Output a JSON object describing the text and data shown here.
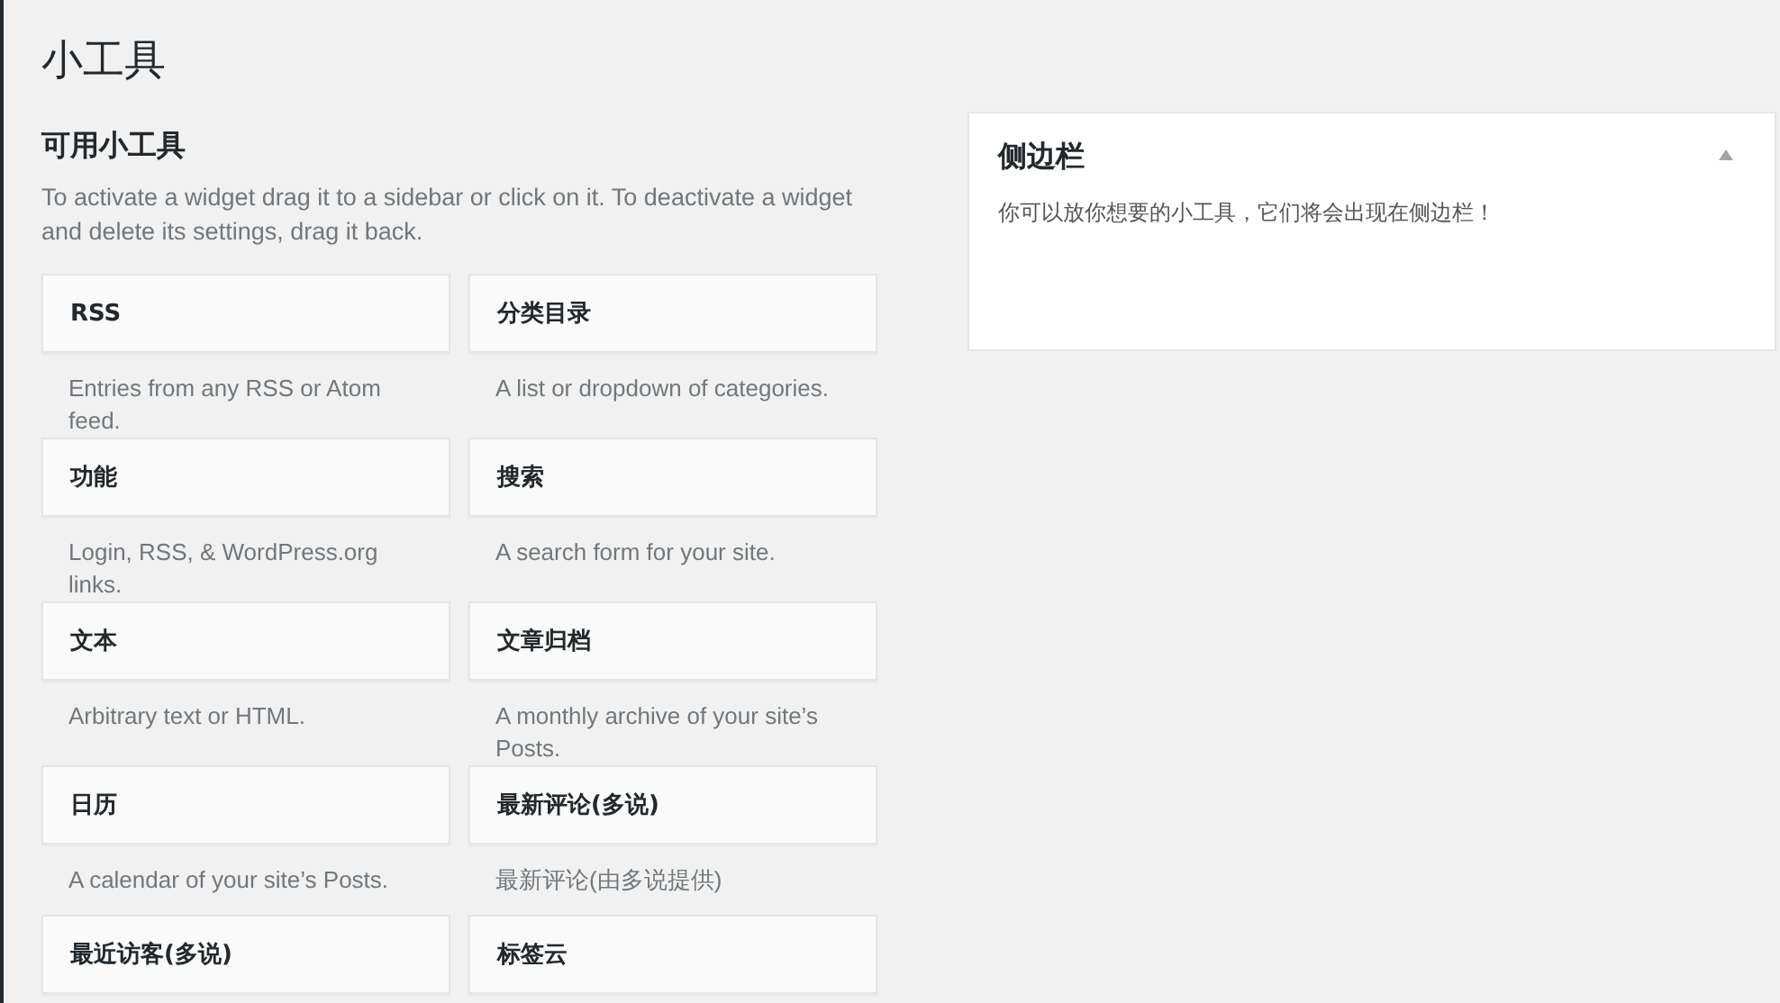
{
  "page_title": "小工具",
  "available": {
    "heading": "可用小工具",
    "description": "To activate a widget drag it to a sidebar or click on it. To deactivate a widget and delete its settings, drag it back.",
    "widgets": [
      {
        "title": "RSS",
        "description": "Entries from any RSS or Atom feed."
      },
      {
        "title": "分类目录",
        "description": "A list or dropdown of categories."
      },
      {
        "title": "功能",
        "description": "Login, RSS, & WordPress.org links."
      },
      {
        "title": "搜索",
        "description": "A search form for your site."
      },
      {
        "title": "文本",
        "description": "Arbitrary text or HTML."
      },
      {
        "title": "文章归档",
        "description": "A monthly archive of your site’s Posts."
      },
      {
        "title": "日历",
        "description": "A calendar of your site’s Posts."
      },
      {
        "title": "最新评论(多说)",
        "description": "最新评论(由多说提供)"
      },
      {
        "title": "最近访客(多说)"
      },
      {
        "title": "标签云"
      }
    ]
  },
  "sidebar": {
    "title": "侧边栏",
    "expanded": true,
    "description": "你可以放你想要的小工具，它们将会出现在侧边栏！"
  }
}
